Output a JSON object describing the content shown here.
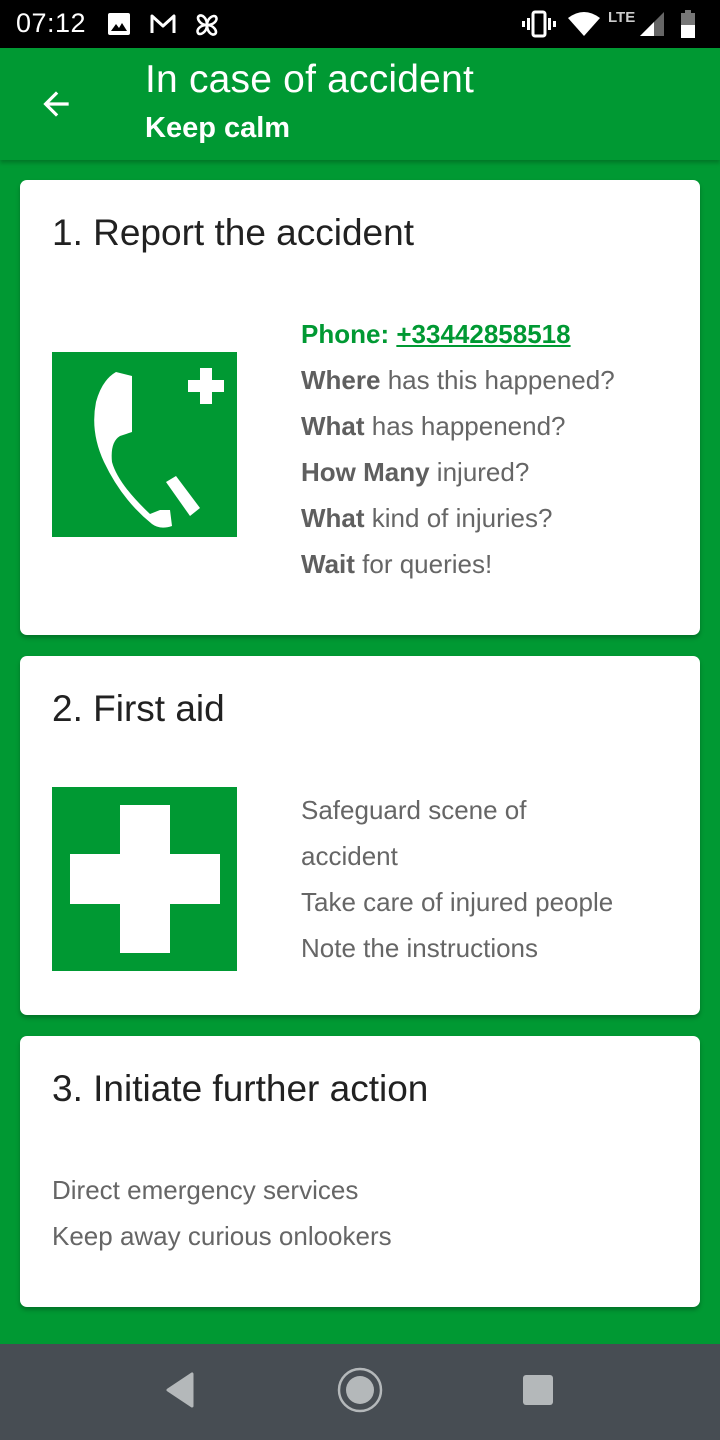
{
  "status_bar": {
    "time": "07:12",
    "left_icons": [
      "image-icon",
      "gmail-icon",
      "pinwheel-icon"
    ],
    "right_icons": [
      "vibrate-icon",
      "wifi-icon",
      "lte-signal-icon",
      "battery-icon"
    ],
    "network_label": "LTE"
  },
  "app_bar": {
    "back_icon": "arrow-left-icon",
    "title": "In case of accident",
    "subtitle": "Keep calm"
  },
  "colors": {
    "primary": "#009933",
    "card_bg": "#ffffff",
    "nav_bar": "#474d53"
  },
  "cards": [
    {
      "title": "1. Report the accident",
      "icon": "emergency-phone-sign-icon",
      "phone_label": "Phone: ",
      "phone_number": "+33442858518",
      "lines": [
        {
          "bold": "Where",
          "rest": " has this happened?"
        },
        {
          "bold": "What",
          "rest": " has happenend?"
        },
        {
          "bold": "How Many",
          "rest": " injured?"
        },
        {
          "bold": "What",
          "rest": " kind of injuries?"
        },
        {
          "bold": "Wait",
          "rest": " for queries!"
        }
      ]
    },
    {
      "title": "2. First aid",
      "icon": "first-aid-cross-sign-icon",
      "lines": [
        "Safeguard scene of",
        "accident",
        "Take care of injured people",
        "Note the instructions"
      ]
    },
    {
      "title": "3. Initiate further action",
      "lines": [
        "Direct emergency services",
        "Keep away curious onlookers"
      ]
    }
  ],
  "nav_bar": {
    "buttons": [
      "back-nav-icon",
      "home-nav-icon",
      "recents-nav-icon"
    ]
  }
}
